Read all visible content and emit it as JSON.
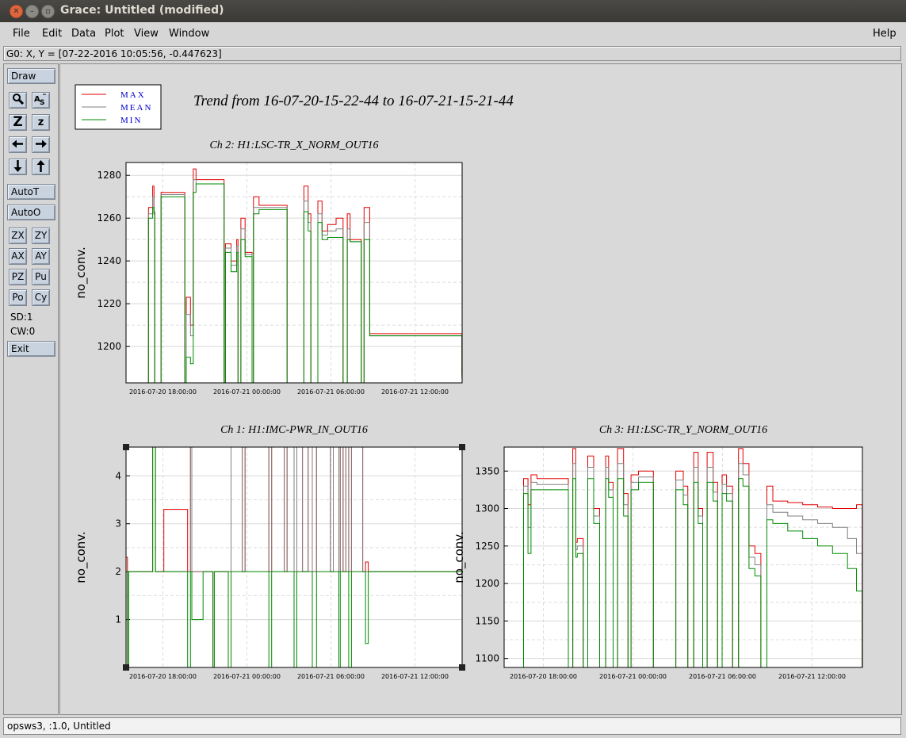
{
  "window": {
    "title": "Grace: Untitled (modified)"
  },
  "menu": [
    "File",
    "Edit",
    "Data",
    "Plot",
    "View",
    "Window"
  ],
  "menu_help": "Help",
  "locator": "G0: X, Y = [07-22-2016 10:05:56, -0.447623]",
  "toolbar": {
    "draw": "Draw",
    "autot": "AutoT",
    "autoo": "AutoO",
    "zx": "ZX",
    "zy": "ZY",
    "ax": "AX",
    "ay": "AY",
    "pz": "PZ",
    "pu": "Pu",
    "po": "Po",
    "cy": "Cy",
    "sd": "SD:1",
    "cw": "CW:0",
    "exit": "Exit",
    "icon_z_big": "Z",
    "icon_z_small": "z"
  },
  "status": "opsws3, :1.0, Untitled",
  "legend": [
    "MAX",
    "MEAN",
    "MIN"
  ],
  "main_title": "Trend from 16-07-20-15-22-44 to 16-07-21-15-21-44",
  "colors": {
    "max": "#e00000",
    "mean": "#808080",
    "min": "#008c00",
    "legend_text": "#0000cc"
  },
  "chart_data": [
    {
      "type": "line",
      "title": "Ch 2: H1:LSC-TR_X_NORM_OUT16",
      "ylabel": "no_conv.",
      "ylim": [
        1183,
        1286
      ],
      "yticks": [
        "1200",
        "1220",
        "1240",
        "1260",
        "1280"
      ],
      "xticks": [
        "2016-07-20 18:00:00",
        "2016-07-21 00:00:00",
        "2016-07-21 06:00:00",
        "2016-07-21 12:00:00"
      ],
      "x_hours": [
        0,
        1.5,
        1.6,
        1.9,
        2.0,
        2.05,
        2.5,
        2.6,
        4.2,
        4.3,
        4.6,
        4.8,
        5.0,
        7.0,
        7.1,
        7.5,
        7.9,
        8.0,
        8.2,
        8.5,
        9.0,
        9.1,
        9.5,
        10.0,
        11.5,
        12.5,
        12.7,
        13.0,
        13.2,
        13.7,
        14.0,
        14.4,
        15.0,
        15.5,
        15.8,
        16.0,
        16.3,
        16.8,
        17.0,
        17.4,
        18.0,
        19.5,
        20.0,
        20.6,
        21.0,
        22.0,
        23.99
      ],
      "max": [
        1183,
        1183,
        1265,
        1275,
        1263,
        1183,
        1272,
        1272,
        1183,
        1223,
        1210,
        1283,
        1278,
        1183,
        1248,
        1240,
        1250,
        1183,
        1260,
        1244,
        1183,
        1270,
        1266,
        1266,
        1183,
        1183,
        1275,
        1262,
        1183,
        1268,
        1254,
        1257,
        1260,
        1183,
        1262,
        1250,
        1250,
        1183,
        1265,
        1206,
        1206,
        1206,
        1206,
        1206,
        1206,
        1206,
        1187
      ],
      "mean": [
        1183,
        1183,
        1262,
        1270,
        1263,
        1183,
        1271,
        1271,
        1183,
        1215,
        1205,
        1278,
        1276,
        1183,
        1246,
        1238,
        1247,
        1183,
        1255,
        1243,
        1183,
        1265,
        1265,
        1265,
        1183,
        1183,
        1268,
        1258,
        1183,
        1262,
        1252,
        1254,
        1255,
        1183,
        1255,
        1249,
        1249,
        1183,
        1258,
        1205,
        1205,
        1205,
        1205,
        1205,
        1205,
        1205,
        1186
      ],
      "min": [
        1183,
        1183,
        1260,
        1265,
        1262,
        1183,
        1270,
        1270,
        1183,
        1195,
        1192,
        1272,
        1276,
        1183,
        1244,
        1235,
        1244,
        1183,
        1250,
        1242,
        1183,
        1262,
        1264,
        1264,
        1183,
        1183,
        1263,
        1254,
        1183,
        1258,
        1250,
        1251,
        1251,
        1183,
        1250,
        1249,
        1249,
        1183,
        1250,
        1205,
        1205,
        1205,
        1205,
        1205,
        1205,
        1205,
        1185
      ]
    },
    {
      "type": "line",
      "title": "Ch 1: H1:IMC-PWR_IN_OUT16",
      "ylabel": "no_conv.",
      "ylim": [
        0,
        4.6
      ],
      "yticks": [
        "1",
        "2",
        "3",
        "4"
      ],
      "xticks": [
        "2016-07-20 18:00:00",
        "2016-07-21 00:00:00",
        "2016-07-21 06:00:00",
        "2016-07-21 12:00:00"
      ],
      "x_hours": [
        0,
        0.1,
        0.2,
        1.8,
        1.9,
        2.1,
        2.6,
        2.7,
        4.4,
        4.6,
        4.7,
        5.5,
        6.2,
        6.3,
        7.3,
        7.5,
        8.3,
        8.5,
        10.2,
        10.4,
        11.3,
        11.5,
        12.0,
        12.2,
        12.6,
        13.0,
        13.3,
        13.6,
        14.6,
        14.8,
        15.2,
        15.3,
        15.5,
        15.7,
        15.9,
        16.1,
        16.9,
        17.1,
        17.3,
        20.0,
        23.99
      ],
      "max": [
        2.3,
        0.0,
        2.0,
        2.0,
        4.6,
        2.0,
        2.0,
        3.3,
        2.0,
        4.6,
        2.0,
        2.0,
        0.0,
        2.0,
        2.0,
        4.6,
        2.0,
        4.6,
        2.0,
        4.6,
        2.0,
        4.6,
        2.0,
        4.6,
        2.0,
        4.6,
        2.0,
        4.6,
        2.0,
        4.6,
        2.0,
        4.6,
        2.0,
        4.6,
        2.0,
        4.6,
        2.0,
        2.2,
        2.0,
        2.0,
        2.1
      ],
      "mean": [
        2.0,
        0.0,
        2.0,
        2.0,
        4.6,
        2.0,
        2.0,
        2.0,
        2.0,
        4.6,
        2.0,
        2.0,
        0.0,
        2.0,
        2.0,
        4.6,
        2.0,
        4.6,
        2.0,
        4.6,
        2.0,
        4.6,
        2.0,
        4.6,
        2.0,
        4.6,
        2.0,
        4.6,
        2.0,
        4.6,
        2.0,
        4.6,
        2.0,
        4.6,
        2.0,
        4.6,
        2.0,
        2.0,
        2.0,
        2.0,
        2.0
      ],
      "min": [
        2.0,
        0.0,
        2.0,
        2.0,
        4.6,
        2.0,
        2.0,
        2.0,
        0.0,
        2.0,
        1.0,
        2.0,
        0.0,
        2.0,
        0.0,
        2.0,
        2.0,
        2.0,
        0.0,
        2.0,
        2.0,
        2.0,
        0.0,
        2.0,
        2.0,
        2.0,
        0.0,
        2.0,
        2.0,
        2.0,
        0.0,
        2.0,
        2.0,
        2.0,
        0.0,
        2.0,
        2.0,
        0.5,
        2.0,
        2.0,
        2.0
      ]
    },
    {
      "type": "line",
      "title": "Ch 3: H1:LSC-TR_Y_NORM_OUT16",
      "ylabel": "no_conv.",
      "ylim": [
        1088,
        1382
      ],
      "yticks": [
        "1100",
        "1150",
        "1200",
        "1250",
        "1300",
        "1350"
      ],
      "xticks": [
        "2016-07-20 18:00:00",
        "2016-07-21 00:00:00",
        "2016-07-21 06:00:00",
        "2016-07-21 12:00:00"
      ],
      "x_hours": [
        0,
        1.2,
        1.3,
        1.6,
        1.8,
        2.2,
        2.5,
        3.8,
        4.3,
        4.6,
        4.8,
        4.9,
        5.3,
        5.6,
        6.0,
        6.4,
        6.8,
        7.0,
        7.3,
        7.6,
        8.0,
        8.3,
        8.5,
        9.0,
        9.5,
        10.0,
        10.5,
        11.0,
        11.5,
        12.0,
        12.3,
        12.7,
        13.0,
        13.3,
        13.6,
        14.0,
        14.3,
        14.6,
        14.9,
        15.3,
        15.7,
        16.0,
        16.4,
        16.8,
        17.2,
        17.6,
        18.0,
        19.0,
        20.0,
        21.0,
        22.0,
        23.0,
        23.6,
        23.99
      ],
      "max": [
        1088,
        1088,
        1340,
        1305,
        1345,
        1340,
        1340,
        1340,
        1088,
        1380,
        1255,
        1260,
        1088,
        1370,
        1300,
        1088,
        1370,
        1335,
        1088,
        1380,
        1320,
        1088,
        1345,
        1350,
        1350,
        1088,
        1088,
        1088,
        1350,
        1330,
        1088,
        1375,
        1300,
        1088,
        1375,
        1335,
        1088,
        1345,
        1330,
        1088,
        1380,
        1360,
        1250,
        1240,
        1088,
        1330,
        1310,
        1308,
        1305,
        1302,
        1300,
        1300,
        1305,
        1088
      ],
      "mean": [
        1088,
        1088,
        1330,
        1275,
        1335,
        1332,
        1332,
        1332,
        1088,
        1360,
        1245,
        1250,
        1088,
        1355,
        1290,
        1088,
        1355,
        1325,
        1088,
        1360,
        1305,
        1088,
        1335,
        1342,
        1342,
        1088,
        1088,
        1088,
        1338,
        1318,
        1088,
        1355,
        1290,
        1088,
        1355,
        1322,
        1088,
        1332,
        1320,
        1088,
        1360,
        1345,
        1235,
        1225,
        1088,
        1305,
        1295,
        1290,
        1285,
        1280,
        1275,
        1260,
        1240,
        1088
      ],
      "min": [
        1088,
        1088,
        1320,
        1240,
        1325,
        1325,
        1325,
        1325,
        1088,
        1340,
        1235,
        1240,
        1088,
        1340,
        1280,
        1088,
        1340,
        1315,
        1088,
        1340,
        1290,
        1088,
        1325,
        1335,
        1335,
        1088,
        1088,
        1088,
        1325,
        1305,
        1088,
        1335,
        1280,
        1088,
        1335,
        1310,
        1088,
        1320,
        1310,
        1088,
        1340,
        1330,
        1220,
        1210,
        1088,
        1285,
        1280,
        1270,
        1260,
        1250,
        1240,
        1220,
        1190,
        1088
      ]
    }
  ]
}
